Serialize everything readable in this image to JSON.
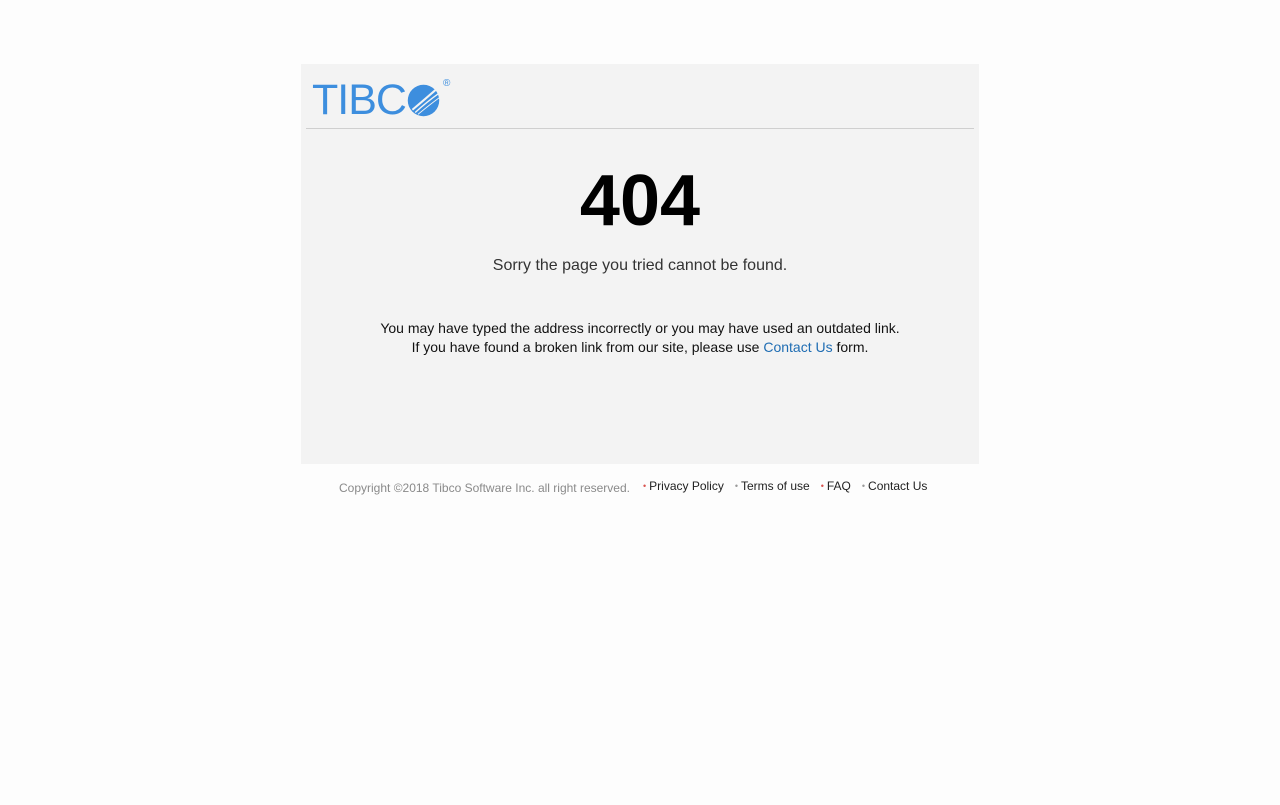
{
  "logo": {
    "text": "TIBC",
    "registered": "®",
    "color": "#3d8ede"
  },
  "error": {
    "code": "404",
    "message": "Sorry the page you tried cannot be found."
  },
  "explanation": {
    "line1": "You may have typed the address incorrectly or you may have used an outdated link.",
    "line2_prefix": "If you have found a broken link from our site, please use ",
    "line2_link": "Contact Us",
    "line2_suffix": " form."
  },
  "footer": {
    "copyright": "Copyright ©2018 Tibco Software Inc. all right reserved.",
    "links": [
      {
        "label": "Privacy Policy",
        "bullet": "•",
        "bullet_color": "#d9534f"
      },
      {
        "label": "Terms of use",
        "bullet": "•",
        "bullet_color": "#999999"
      },
      {
        "label": "FAQ",
        "bullet": "•",
        "bullet_color": "#d9534f"
      },
      {
        "label": "Contact Us",
        "bullet": "•",
        "bullet_color": "#999999"
      }
    ]
  },
  "colors": {
    "card_background": "#f3f3f3",
    "link": "#1f6db3"
  }
}
